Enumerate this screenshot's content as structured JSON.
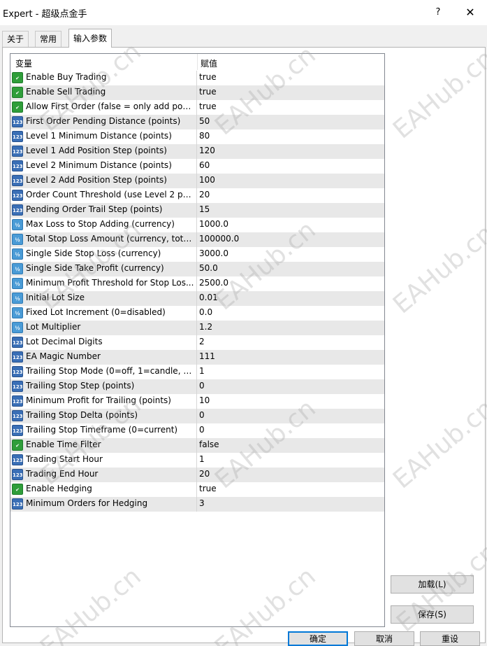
{
  "window": {
    "title": "Expert - 超级点金手",
    "help_label": "?",
    "close_label": "✕"
  },
  "tabs": [
    {
      "label": "关于",
      "active": false
    },
    {
      "label": "常用",
      "active": false
    },
    {
      "label": "输入参数",
      "active": true
    }
  ],
  "grid": {
    "col_variable": "变量",
    "col_value": "赋值",
    "rows": [
      {
        "name": "Enable Buy Trading",
        "value": "true",
        "type": "bool-icon"
      },
      {
        "name": "Enable Sell Trading",
        "value": "true",
        "type": "bool-icon"
      },
      {
        "name": "Allow First Order (false = only add posi...",
        "value": "true",
        "type": "bool-icon"
      },
      {
        "name": "First Order Pending Distance (points)",
        "value": "50",
        "type": "int-icon"
      },
      {
        "name": "Level 1 Minimum Distance (points)",
        "value": "80",
        "type": "int-icon"
      },
      {
        "name": "Level 1 Add Position Step (points)",
        "value": "120",
        "type": "int-icon"
      },
      {
        "name": "Level 2 Minimum Distance (points)",
        "value": "60",
        "type": "int-icon"
      },
      {
        "name": "Level 2 Add Position Step (points)",
        "value": "100",
        "type": "int-icon"
      },
      {
        "name": "Order Count Threshold (use Level 2 par...",
        "value": "20",
        "type": "int-icon"
      },
      {
        "name": "Pending Order Trail Step (points)",
        "value": "15",
        "type": "int-icon"
      },
      {
        "name": "Max Loss to Stop Adding (currency)",
        "value": "1000.0",
        "type": "double-icon"
      },
      {
        "name": "Total Stop Loss Amount (currency, total...",
        "value": "100000.0",
        "type": "double-icon"
      },
      {
        "name": "Single Side Stop Loss (currency)",
        "value": "3000.0",
        "type": "double-icon"
      },
      {
        "name": "Single Side Take Profit (currency)",
        "value": "50.0",
        "type": "double-icon"
      },
      {
        "name": "Minimum Profit Threshold for Stop Los...",
        "value": "2500.0",
        "type": "double-icon"
      },
      {
        "name": "Initial Lot Size",
        "value": "0.01",
        "type": "double-icon"
      },
      {
        "name": "Fixed Lot Increment (0=disabled)",
        "value": "0.0",
        "type": "double-icon"
      },
      {
        "name": "Lot Multiplier",
        "value": "1.2",
        "type": "double-icon"
      },
      {
        "name": "Lot Decimal Digits",
        "value": "2",
        "type": "int-icon"
      },
      {
        "name": "EA Magic Number",
        "value": "111",
        "type": "int-icon"
      },
      {
        "name": "Trailing Stop Mode (0=off, 1=candle, 2...",
        "value": "1",
        "type": "int-icon"
      },
      {
        "name": "Trailing Stop Step (points)",
        "value": "0",
        "type": "int-icon"
      },
      {
        "name": "Minimum Profit for Trailing (points)",
        "value": "10",
        "type": "int-icon"
      },
      {
        "name": "Trailing Stop Delta (points)",
        "value": "0",
        "type": "int-icon"
      },
      {
        "name": "Trailing Stop Timeframe (0=current)",
        "value": "0",
        "type": "int-icon"
      },
      {
        "name": "Enable Time Filter",
        "value": "false",
        "type": "bool-icon"
      },
      {
        "name": "Trading Start Hour",
        "value": "1",
        "type": "int-icon"
      },
      {
        "name": "Trading End Hour",
        "value": "20",
        "type": "int-icon"
      },
      {
        "name": "Enable Hedging",
        "value": "true",
        "type": "bool-icon"
      },
      {
        "name": "Minimum Orders for Hedging",
        "value": "3",
        "type": "int-icon"
      }
    ]
  },
  "buttons": {
    "load": "加载(L)",
    "save": "保存(S)",
    "ok": "确定",
    "cancel": "取消",
    "reset": "重设"
  },
  "watermark": "EAHub.cn"
}
